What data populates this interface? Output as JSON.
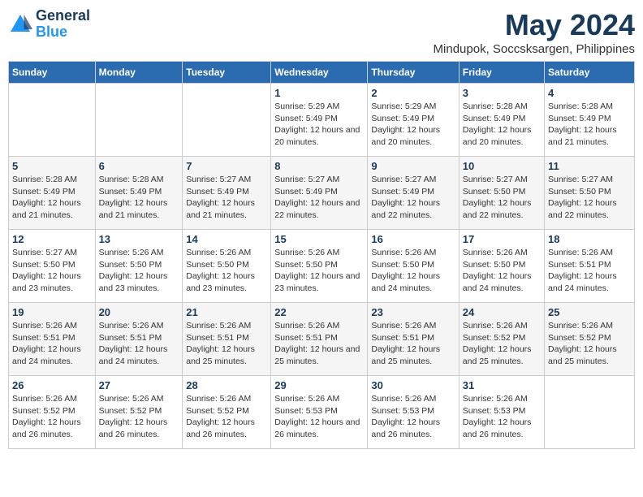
{
  "logo": {
    "line1": "General",
    "line2": "Blue"
  },
  "title": "May 2024",
  "subtitle": "Mindupok, Soccsksargen, Philippines",
  "headers": [
    "Sunday",
    "Monday",
    "Tuesday",
    "Wednesday",
    "Thursday",
    "Friday",
    "Saturday"
  ],
  "weeks": [
    [
      {
        "num": "",
        "sunrise": "",
        "sunset": "",
        "daylight": ""
      },
      {
        "num": "",
        "sunrise": "",
        "sunset": "",
        "daylight": ""
      },
      {
        "num": "",
        "sunrise": "",
        "sunset": "",
        "daylight": ""
      },
      {
        "num": "1",
        "sunrise": "Sunrise: 5:29 AM",
        "sunset": "Sunset: 5:49 PM",
        "daylight": "Daylight: 12 hours and 20 minutes."
      },
      {
        "num": "2",
        "sunrise": "Sunrise: 5:29 AM",
        "sunset": "Sunset: 5:49 PM",
        "daylight": "Daylight: 12 hours and 20 minutes."
      },
      {
        "num": "3",
        "sunrise": "Sunrise: 5:28 AM",
        "sunset": "Sunset: 5:49 PM",
        "daylight": "Daylight: 12 hours and 20 minutes."
      },
      {
        "num": "4",
        "sunrise": "Sunrise: 5:28 AM",
        "sunset": "Sunset: 5:49 PM",
        "daylight": "Daylight: 12 hours and 21 minutes."
      }
    ],
    [
      {
        "num": "5",
        "sunrise": "Sunrise: 5:28 AM",
        "sunset": "Sunset: 5:49 PM",
        "daylight": "Daylight: 12 hours and 21 minutes."
      },
      {
        "num": "6",
        "sunrise": "Sunrise: 5:28 AM",
        "sunset": "Sunset: 5:49 PM",
        "daylight": "Daylight: 12 hours and 21 minutes."
      },
      {
        "num": "7",
        "sunrise": "Sunrise: 5:27 AM",
        "sunset": "Sunset: 5:49 PM",
        "daylight": "Daylight: 12 hours and 21 minutes."
      },
      {
        "num": "8",
        "sunrise": "Sunrise: 5:27 AM",
        "sunset": "Sunset: 5:49 PM",
        "daylight": "Daylight: 12 hours and 22 minutes."
      },
      {
        "num": "9",
        "sunrise": "Sunrise: 5:27 AM",
        "sunset": "Sunset: 5:49 PM",
        "daylight": "Daylight: 12 hours and 22 minutes."
      },
      {
        "num": "10",
        "sunrise": "Sunrise: 5:27 AM",
        "sunset": "Sunset: 5:50 PM",
        "daylight": "Daylight: 12 hours and 22 minutes."
      },
      {
        "num": "11",
        "sunrise": "Sunrise: 5:27 AM",
        "sunset": "Sunset: 5:50 PM",
        "daylight": "Daylight: 12 hours and 22 minutes."
      }
    ],
    [
      {
        "num": "12",
        "sunrise": "Sunrise: 5:27 AM",
        "sunset": "Sunset: 5:50 PM",
        "daylight": "Daylight: 12 hours and 23 minutes."
      },
      {
        "num": "13",
        "sunrise": "Sunrise: 5:26 AM",
        "sunset": "Sunset: 5:50 PM",
        "daylight": "Daylight: 12 hours and 23 minutes."
      },
      {
        "num": "14",
        "sunrise": "Sunrise: 5:26 AM",
        "sunset": "Sunset: 5:50 PM",
        "daylight": "Daylight: 12 hours and 23 minutes."
      },
      {
        "num": "15",
        "sunrise": "Sunrise: 5:26 AM",
        "sunset": "Sunset: 5:50 PM",
        "daylight": "Daylight: 12 hours and 23 minutes."
      },
      {
        "num": "16",
        "sunrise": "Sunrise: 5:26 AM",
        "sunset": "Sunset: 5:50 PM",
        "daylight": "Daylight: 12 hours and 24 minutes."
      },
      {
        "num": "17",
        "sunrise": "Sunrise: 5:26 AM",
        "sunset": "Sunset: 5:50 PM",
        "daylight": "Daylight: 12 hours and 24 minutes."
      },
      {
        "num": "18",
        "sunrise": "Sunrise: 5:26 AM",
        "sunset": "Sunset: 5:51 PM",
        "daylight": "Daylight: 12 hours and 24 minutes."
      }
    ],
    [
      {
        "num": "19",
        "sunrise": "Sunrise: 5:26 AM",
        "sunset": "Sunset: 5:51 PM",
        "daylight": "Daylight: 12 hours and 24 minutes."
      },
      {
        "num": "20",
        "sunrise": "Sunrise: 5:26 AM",
        "sunset": "Sunset: 5:51 PM",
        "daylight": "Daylight: 12 hours and 24 minutes."
      },
      {
        "num": "21",
        "sunrise": "Sunrise: 5:26 AM",
        "sunset": "Sunset: 5:51 PM",
        "daylight": "Daylight: 12 hours and 25 minutes."
      },
      {
        "num": "22",
        "sunrise": "Sunrise: 5:26 AM",
        "sunset": "Sunset: 5:51 PM",
        "daylight": "Daylight: 12 hours and 25 minutes."
      },
      {
        "num": "23",
        "sunrise": "Sunrise: 5:26 AM",
        "sunset": "Sunset: 5:51 PM",
        "daylight": "Daylight: 12 hours and 25 minutes."
      },
      {
        "num": "24",
        "sunrise": "Sunrise: 5:26 AM",
        "sunset": "Sunset: 5:52 PM",
        "daylight": "Daylight: 12 hours and 25 minutes."
      },
      {
        "num": "25",
        "sunrise": "Sunrise: 5:26 AM",
        "sunset": "Sunset: 5:52 PM",
        "daylight": "Daylight: 12 hours and 25 minutes."
      }
    ],
    [
      {
        "num": "26",
        "sunrise": "Sunrise: 5:26 AM",
        "sunset": "Sunset: 5:52 PM",
        "daylight": "Daylight: 12 hours and 26 minutes."
      },
      {
        "num": "27",
        "sunrise": "Sunrise: 5:26 AM",
        "sunset": "Sunset: 5:52 PM",
        "daylight": "Daylight: 12 hours and 26 minutes."
      },
      {
        "num": "28",
        "sunrise": "Sunrise: 5:26 AM",
        "sunset": "Sunset: 5:52 PM",
        "daylight": "Daylight: 12 hours and 26 minutes."
      },
      {
        "num": "29",
        "sunrise": "Sunrise: 5:26 AM",
        "sunset": "Sunset: 5:53 PM",
        "daylight": "Daylight: 12 hours and 26 minutes."
      },
      {
        "num": "30",
        "sunrise": "Sunrise: 5:26 AM",
        "sunset": "Sunset: 5:53 PM",
        "daylight": "Daylight: 12 hours and 26 minutes."
      },
      {
        "num": "31",
        "sunrise": "Sunrise: 5:26 AM",
        "sunset": "Sunset: 5:53 PM",
        "daylight": "Daylight: 12 hours and 26 minutes."
      },
      {
        "num": "",
        "sunrise": "",
        "sunset": "",
        "daylight": ""
      }
    ]
  ]
}
